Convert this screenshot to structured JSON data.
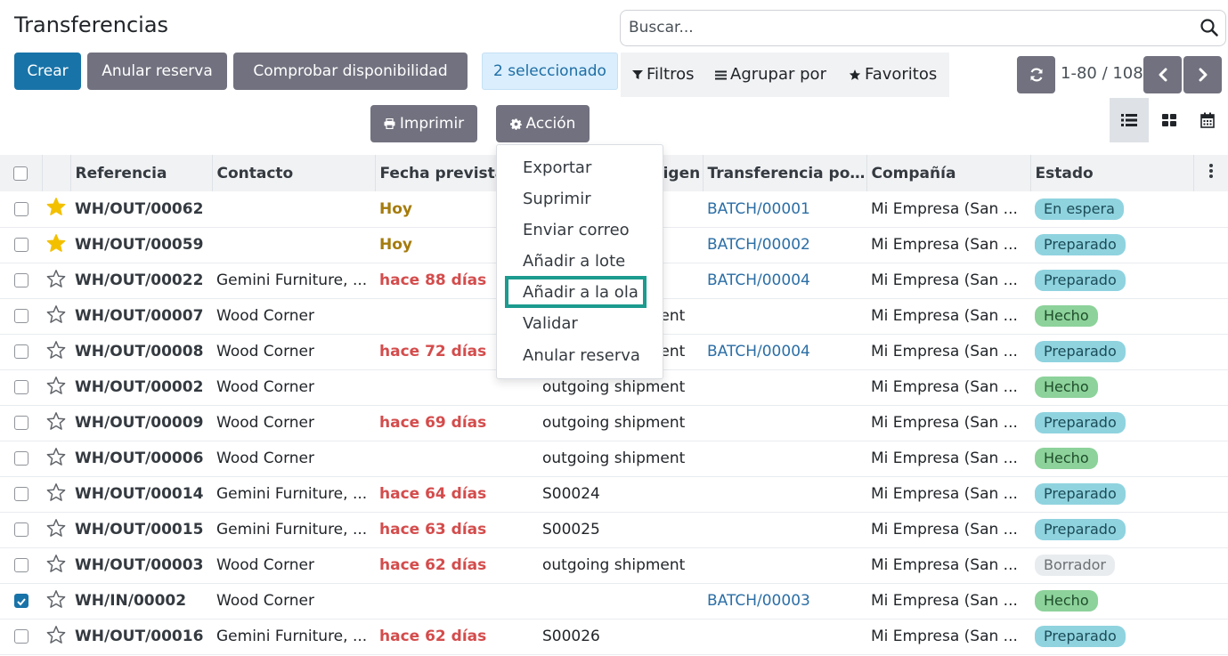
{
  "page": {
    "title": "Transferencias"
  },
  "search": {
    "placeholder": "Buscar..."
  },
  "toolbar": {
    "create_label": "Crear",
    "unreserve_label": "Anular reserva",
    "check_availability_label": "Comprobar disponibilidad",
    "selected_label": "2 seleccionado",
    "print_label": "Imprimir",
    "action_label": "Acción"
  },
  "filters": {
    "filters_label": "Filtros",
    "group_by_label": "Agrupar por",
    "favorites_label": "Favoritos"
  },
  "pager": {
    "value": "1-80 / 108"
  },
  "action_menu": {
    "items": [
      {
        "label": "Exportar"
      },
      {
        "label": "Suprimir"
      },
      {
        "label": "Enviar correo"
      },
      {
        "label": "Añadir a lote"
      },
      {
        "label": "Añadir a la ola"
      },
      {
        "label": "Validar"
      },
      {
        "label": "Anular reserva"
      }
    ],
    "highlighted_index": 4
  },
  "table": {
    "columns": {
      "reference": "Referencia",
      "contact": "Contacto",
      "scheduled_date": "Fecha prevista",
      "source_document": "Documento origen",
      "batch": "Transferencia po...",
      "company": "Compañía",
      "status": "Estado"
    },
    "rows": [
      {
        "checked": false,
        "starred": true,
        "reference": "WH/OUT/00062",
        "contact": "",
        "date": "Hoy",
        "date_state": "today",
        "source": "",
        "batch": "BATCH/00001",
        "company": "Mi Empresa (San ...",
        "status": "En espera",
        "status_state": "info"
      },
      {
        "checked": false,
        "starred": true,
        "reference": "WH/OUT/00059",
        "contact": "",
        "date": "Hoy",
        "date_state": "today",
        "source": "",
        "batch": "BATCH/00002",
        "company": "Mi Empresa (San ...",
        "status": "Preparado",
        "status_state": "info"
      },
      {
        "checked": false,
        "starred": false,
        "reference": "WH/OUT/00022",
        "contact": "Gemini Furniture, ...",
        "date": "hace 88 días",
        "date_state": "late",
        "source": "",
        "batch": "BATCH/00004",
        "company": "Mi Empresa (San ...",
        "status": "Preparado",
        "status_state": "info"
      },
      {
        "checked": false,
        "starred": false,
        "reference": "WH/OUT/00007",
        "contact": "Wood Corner",
        "date": "",
        "date_state": "none",
        "source": "outgoing shipment",
        "batch": "",
        "company": "Mi Empresa (San ...",
        "status": "Hecho",
        "status_state": "success"
      },
      {
        "checked": false,
        "starred": false,
        "reference": "WH/OUT/00008",
        "contact": "Wood Corner",
        "date": "hace 72 días",
        "date_state": "late",
        "source": "outgoing shipment",
        "batch": "BATCH/00004",
        "company": "Mi Empresa (San ...",
        "status": "Preparado",
        "status_state": "info"
      },
      {
        "checked": false,
        "starred": false,
        "reference": "WH/OUT/00002",
        "contact": "Wood Corner",
        "date": "",
        "date_state": "none",
        "source": "outgoing shipment",
        "batch": "",
        "company": "Mi Empresa (San ...",
        "status": "Hecho",
        "status_state": "success"
      },
      {
        "checked": false,
        "starred": false,
        "reference": "WH/OUT/00009",
        "contact": "Wood Corner",
        "date": "hace 69 días",
        "date_state": "late",
        "source": "outgoing shipment",
        "batch": "",
        "company": "Mi Empresa (San ...",
        "status": "Preparado",
        "status_state": "info"
      },
      {
        "checked": false,
        "starred": false,
        "reference": "WH/OUT/00006",
        "contact": "Wood Corner",
        "date": "",
        "date_state": "none",
        "source": "outgoing shipment",
        "batch": "",
        "company": "Mi Empresa (San ...",
        "status": "Hecho",
        "status_state": "success"
      },
      {
        "checked": false,
        "starred": false,
        "reference": "WH/OUT/00014",
        "contact": "Gemini Furniture, ...",
        "date": "hace 64 días",
        "date_state": "late",
        "source": "S00024",
        "batch": "",
        "company": "Mi Empresa (San ...",
        "status": "Preparado",
        "status_state": "info"
      },
      {
        "checked": false,
        "starred": false,
        "reference": "WH/OUT/00015",
        "contact": "Gemini Furniture, ...",
        "date": "hace 63 días",
        "date_state": "late",
        "source": "S00025",
        "batch": "",
        "company": "Mi Empresa (San ...",
        "status": "Preparado",
        "status_state": "info"
      },
      {
        "checked": false,
        "starred": false,
        "reference": "WH/OUT/00003",
        "contact": "Wood Corner",
        "date": "hace 62 días",
        "date_state": "late",
        "source": "outgoing shipment",
        "batch": "",
        "company": "Mi Empresa (San ...",
        "status": "Borrador",
        "status_state": "draft"
      },
      {
        "checked": true,
        "starred": false,
        "reference": "WH/IN/00002",
        "contact": "Wood Corner",
        "date": "",
        "date_state": "none",
        "source": "",
        "batch": "BATCH/00003",
        "company": "Mi Empresa (San ...",
        "status": "Hecho",
        "status_state": "success"
      },
      {
        "checked": false,
        "starred": false,
        "reference": "WH/OUT/00016",
        "contact": "Gemini Furniture, ...",
        "date": "hace 62 días",
        "date_state": "late",
        "source": "S00026",
        "batch": "",
        "company": "Mi Empresa (San ...",
        "status": "Preparado",
        "status_state": "info"
      }
    ]
  },
  "colors": {
    "primary": "#1873a8",
    "secondary": "#71717f",
    "highlight": "#1c9b8f",
    "late_date": "#d44c4c",
    "today_date": "#a57b0d",
    "star": "#f3c000"
  },
  "icons": {
    "search": "search-icon",
    "filter": "filter-icon",
    "group_by": "list-icon",
    "favorites": "star-icon",
    "refresh": "refresh-icon",
    "prev": "chevron-left-icon",
    "next": "chevron-right-icon",
    "list_view": "list-view-icon",
    "kanban_view": "kanban-view-icon",
    "calendar_view": "calendar-view-icon",
    "print": "printer-icon",
    "action": "gear-icon"
  }
}
